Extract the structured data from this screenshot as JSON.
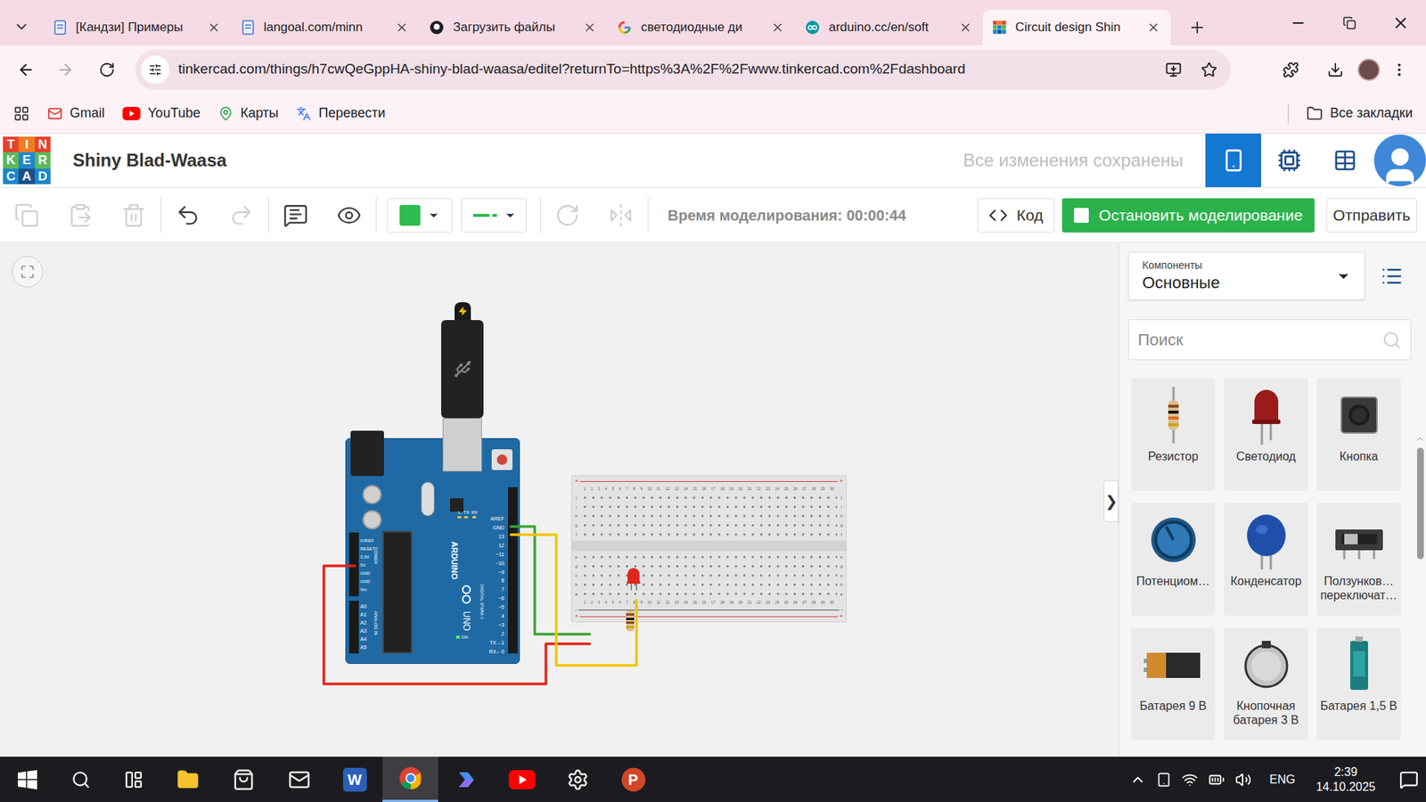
{
  "browser": {
    "tabs": [
      {
        "label": "[Кандзи] Примеры",
        "kind": "doc",
        "selected": false
      },
      {
        "label": "langoal.com/minn",
        "kind": "doc",
        "selected": false
      },
      {
        "label": "Загрузить файлы",
        "kind": "github",
        "selected": false
      },
      {
        "label": "светодиодные ди",
        "kind": "google",
        "selected": false
      },
      {
        "label": "arduino.cc/en/soft",
        "kind": "arduino",
        "selected": false
      },
      {
        "label": "Circuit design Shin",
        "kind": "tinkercad",
        "selected": true
      }
    ],
    "url": "tinkercad.com/things/h7cwQeGppHA-shiny-blad-waasa/editel?returnTo=https%3A%2F%2Fwww.tinkercad.com%2Fdashboard",
    "bookmarks": [
      {
        "label": "Gmail",
        "kind": "gmail"
      },
      {
        "label": "YouTube",
        "kind": "youtube"
      },
      {
        "label": "Карты",
        "kind": "maps"
      },
      {
        "label": "Перевести",
        "kind": "translate"
      }
    ],
    "all_bookmarks": "Все закладки"
  },
  "app": {
    "logo": [
      "T",
      "I",
      "N",
      "K",
      "E",
      "R",
      "C",
      "A",
      "D"
    ],
    "title": "Shiny Blad-Waasa",
    "save_status": "Все изменения сохранены",
    "views": [
      {
        "kind": "circuit",
        "selected": true
      },
      {
        "kind": "schematic",
        "selected": false
      },
      {
        "kind": "list",
        "selected": false
      }
    ]
  },
  "toolbar": {
    "tools": [
      {
        "kind": "copy",
        "disabled": true
      },
      {
        "kind": "paste",
        "disabled": true
      },
      {
        "kind": "delete",
        "disabled": true
      },
      {
        "kind": "undo",
        "disabled": false
      },
      {
        "kind": "redo",
        "disabled": true
      },
      {
        "kind": "note",
        "disabled": false
      },
      {
        "kind": "visibility",
        "disabled": false
      }
    ],
    "wire_color": "#2ebd4f",
    "wire_style": "solid",
    "transform_tools": [
      {
        "kind": "rotate",
        "disabled": true
      },
      {
        "kind": "mirror",
        "disabled": true
      }
    ],
    "sim_time": "Время моделирования: 00:00:44",
    "code_button": "Код",
    "sim_button": "Остановить моделирование",
    "send_button": "Отправить"
  },
  "canvas": {
    "arduino": {
      "brand": "ARDUINO",
      "model": "UNO",
      "digital_label": "DIGITAL (PWM~)",
      "power_label": "POWER",
      "analog_label": "ANALOG IN",
      "digital_pins": [
        "AREF",
        "GND",
        "13",
        "12",
        "~11",
        "~10",
        "~9",
        "8",
        "7",
        "~6",
        "~5",
        "4",
        "~3",
        "2",
        "TX→1",
        "RX←0"
      ],
      "power_pins": [
        "IOREF",
        "RESET",
        "3.3V",
        "5V",
        "GND",
        "GND",
        "Vin"
      ],
      "analog_pins": [
        "A0",
        "A1",
        "A2",
        "A3",
        "A4",
        "A5"
      ],
      "led_labels": [
        "L",
        "TX",
        "RX"
      ],
      "on_label": "ON",
      "usb_connected": true
    },
    "breadboard": {
      "rows_top": [
        "j",
        "i",
        "h",
        "g",
        "f"
      ],
      "rows_bottom": [
        "e",
        "d",
        "c",
        "b",
        "a"
      ],
      "columns": [
        "1",
        "2",
        "3",
        "4",
        "5",
        "6",
        "7",
        "8",
        "9",
        "10",
        "11",
        "12",
        "13",
        "14",
        "15",
        "16",
        "17",
        "18",
        "19",
        "20",
        "21",
        "22",
        "23",
        "24",
        "25",
        "26",
        "27",
        "28",
        "29",
        "30"
      ],
      "plus": "+",
      "minus": "-"
    },
    "led": {
      "color": "#e0261c",
      "lit": false
    },
    "resistor": {
      "bands": [
        "#8b4a1c",
        "#111111",
        "#8b4a1c",
        "#c9a227"
      ]
    },
    "wires": [
      {
        "color": "#e2231a"
      },
      {
        "color": "#3aa535"
      },
      {
        "color": "#f2c500"
      }
    ]
  },
  "panel": {
    "category_label": "Компоненты",
    "category": "Основные",
    "search_placeholder": "Поиск",
    "toggle": "❯",
    "components": [
      {
        "label": "Резистор",
        "kind": "resistor"
      },
      {
        "label": "Светодиод",
        "kind": "led"
      },
      {
        "label": "Кнопка",
        "kind": "button"
      },
      {
        "label": "Потенциом…",
        "kind": "potentiometer"
      },
      {
        "label": "Конденсатор",
        "kind": "capacitor"
      },
      {
        "label": "Ползунков… переключат…",
        "kind": "slideswitch"
      },
      {
        "label": "Батарея 9 В",
        "kind": "battery9v"
      },
      {
        "label": "Кнопочная батарея 3 В",
        "kind": "coincell"
      },
      {
        "label": "Батарея 1,5 В",
        "kind": "aa"
      }
    ]
  },
  "taskbar": {
    "apps": [
      {
        "kind": "explorer",
        "glyph": "",
        "selected": false
      },
      {
        "kind": "store",
        "glyph": "",
        "selected": false
      },
      {
        "kind": "mail",
        "glyph": "",
        "selected": false
      },
      {
        "kind": "word",
        "glyph": "W",
        "selected": false
      },
      {
        "kind": "chrome",
        "glyph": "",
        "selected": true
      },
      {
        "kind": "copilot",
        "glyph": "",
        "selected": false
      },
      {
        "kind": "youtube",
        "glyph": "",
        "selected": false
      },
      {
        "kind": "settings",
        "glyph": "",
        "selected": false
      },
      {
        "kind": "powerpoint",
        "glyph": "P",
        "selected": false
      }
    ],
    "language": "ENG",
    "time": "2:39",
    "date": "14.10.2025"
  }
}
